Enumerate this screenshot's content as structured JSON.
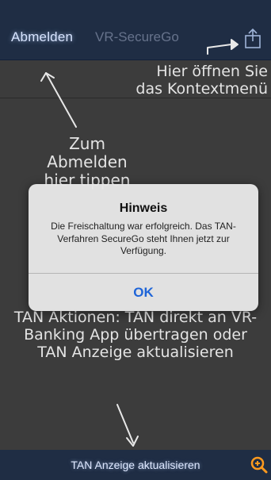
{
  "status_bar": {
    "left": "",
    "time": "",
    "right": ""
  },
  "nav": {
    "left_button": "Abmelden",
    "title": "VR-SecureGo"
  },
  "content": {
    "row_label": "",
    "row_value": ""
  },
  "annotations": {
    "top_right": "Hier öffnen Sie das Kontextmenü",
    "left_middle": "Zum Abmelden hier tippen",
    "bottom": "TAN Aktionen: TAN direkt an VR-Banking App übertragen oder TAN Anzeige aktualisieren"
  },
  "alert": {
    "title": "Hinweis",
    "message": "Die Freischaltung war erfolgreich. Das TAN-Verfahren SecureGo steht Ihnen jetzt zur Verfügung.",
    "ok_label": "OK"
  },
  "bottom_bar": {
    "label": "TAN Anzeige aktualisieren"
  },
  "colors": {
    "nav": "#1f2d44",
    "background": "#3c3c3c",
    "alert_button": "#1e64d8",
    "zoom": "#ff9a1e"
  },
  "icons": [
    "share-icon",
    "zoom-icon"
  ]
}
